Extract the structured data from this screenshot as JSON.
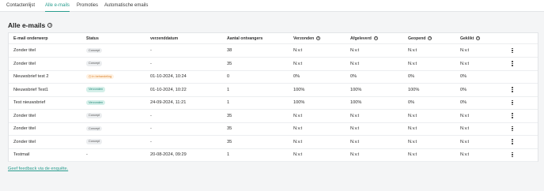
{
  "tabs": [
    {
      "label": "Contactenlijst",
      "active": false
    },
    {
      "label": "Alle e-mails",
      "active": true
    },
    {
      "label": "Promoties",
      "active": false
    },
    {
      "label": "Automatische emails",
      "active": false
    }
  ],
  "page_title": "Alle e-mails",
  "columns": [
    "E-mail onderwerp",
    "Status",
    "verzenddatum",
    "Aantal ontvangers",
    "Verzonden",
    "Afgeleverd",
    "Geopend",
    "Geklikt"
  ],
  "rows": [
    {
      "subject": "Zonder titel",
      "status": "Concept",
      "status_type": "concept",
      "date": "-",
      "recipients": "38",
      "sent": "N.v.t",
      "delivered": "N.v.t",
      "opened": "N.v.t",
      "clicked": "N.v.t",
      "menu": true
    },
    {
      "subject": "Zonder titel",
      "status": "Concept",
      "status_type": "concept",
      "date": "-",
      "recipients": "35",
      "sent": "N.v.t",
      "delivered": "N.v.t",
      "opened": "N.v.t",
      "clicked": "N.v.t",
      "menu": true
    },
    {
      "subject": "Nieuwsbrief test 2",
      "status": "In behandeling",
      "status_type": "progress",
      "date": "01-10-2024, 10:24",
      "recipients": "0",
      "sent": "0%",
      "delivered": "0%",
      "opened": "0%",
      "clicked": "0%",
      "menu": false
    },
    {
      "subject": "Nieuwsbrief Test1",
      "status": "Verzonden",
      "status_type": "sent",
      "date": "01-10-2024, 10:22",
      "recipients": "1",
      "sent": "100%",
      "delivered": "100%",
      "opened": "100%",
      "clicked": "0%",
      "menu": true
    },
    {
      "subject": "Test nieuwsbrief",
      "status": "Verzonden",
      "status_type": "sent",
      "date": "24-09-2024, 11:21",
      "recipients": "1",
      "sent": "100%",
      "delivered": "100%",
      "opened": "0%",
      "clicked": "0%",
      "menu": true
    },
    {
      "subject": "Zonder titel",
      "status": "Concept",
      "status_type": "concept",
      "date": "-",
      "recipients": "35",
      "sent": "N.v.t",
      "delivered": "N.v.t",
      "opened": "N.v.t",
      "clicked": "N.v.t",
      "menu": true
    },
    {
      "subject": "Zonder titel",
      "status": "Concept",
      "status_type": "concept",
      "date": "-",
      "recipients": "35",
      "sent": "N.v.t",
      "delivered": "N.v.t",
      "opened": "N.v.t",
      "clicked": "N.v.t",
      "menu": true
    },
    {
      "subject": "Zonder titel",
      "status": "Concept",
      "status_type": "concept",
      "date": "-",
      "recipients": "35",
      "sent": "N.v.t",
      "delivered": "N.v.t",
      "opened": "N.v.t",
      "clicked": "N.v.t",
      "menu": true
    },
    {
      "subject": "Testmail",
      "status": "-",
      "status_type": "none",
      "date": "20-08-2024, 09:29",
      "recipients": "1",
      "sent": "N.v.t",
      "delivered": "N.v.t",
      "opened": "N.v.t",
      "clicked": "N.v.t",
      "menu": true
    }
  ],
  "feedback_link": "Geef feedback via de enquête.",
  "colors": {
    "accent": "#2a9d8f",
    "badge_progress": "#d9822b",
    "badge_sent": "#2a8c7d"
  }
}
